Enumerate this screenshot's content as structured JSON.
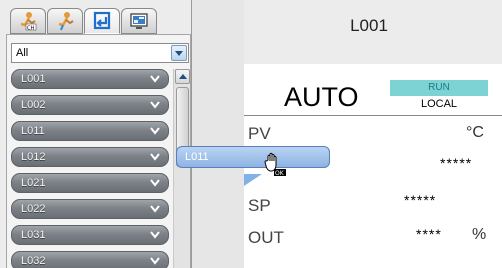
{
  "toolbar": {
    "tabs": [
      {
        "name": "tab-point-ch",
        "icon": "person-ch-icon",
        "label": ""
      },
      {
        "name": "tab-point",
        "icon": "person-icon",
        "label": ""
      },
      {
        "name": "tab-return",
        "icon": "return-arrow-icon",
        "label": ""
      },
      {
        "name": "tab-display",
        "icon": "monitor-icon",
        "label": ""
      }
    ]
  },
  "filter": {
    "value": "All"
  },
  "tags": [
    {
      "label": "L001"
    },
    {
      "label": "L002"
    },
    {
      "label": "L011"
    },
    {
      "label": "L012"
    },
    {
      "label": "L021"
    },
    {
      "label": "L022"
    },
    {
      "label": "L031"
    },
    {
      "label": "L032"
    }
  ],
  "drag": {
    "label": "L011",
    "cursor_badge": "OK"
  },
  "faceplate": {
    "tag": "L001",
    "mode": "AUTO",
    "status": "RUN",
    "location": "LOCAL",
    "pv": {
      "label": "PV",
      "unit": "°C",
      "value": "*****"
    },
    "sp": {
      "label": "SP",
      "value": "*****"
    },
    "out": {
      "label": "OUT",
      "value": "****",
      "unit": "%"
    }
  },
  "colors": {
    "tag_button": "#7d8288",
    "run_badge": "#7dd3d4",
    "drag_ghost": "#a6c4ec",
    "sp_marker": "#7fb2e6"
  }
}
